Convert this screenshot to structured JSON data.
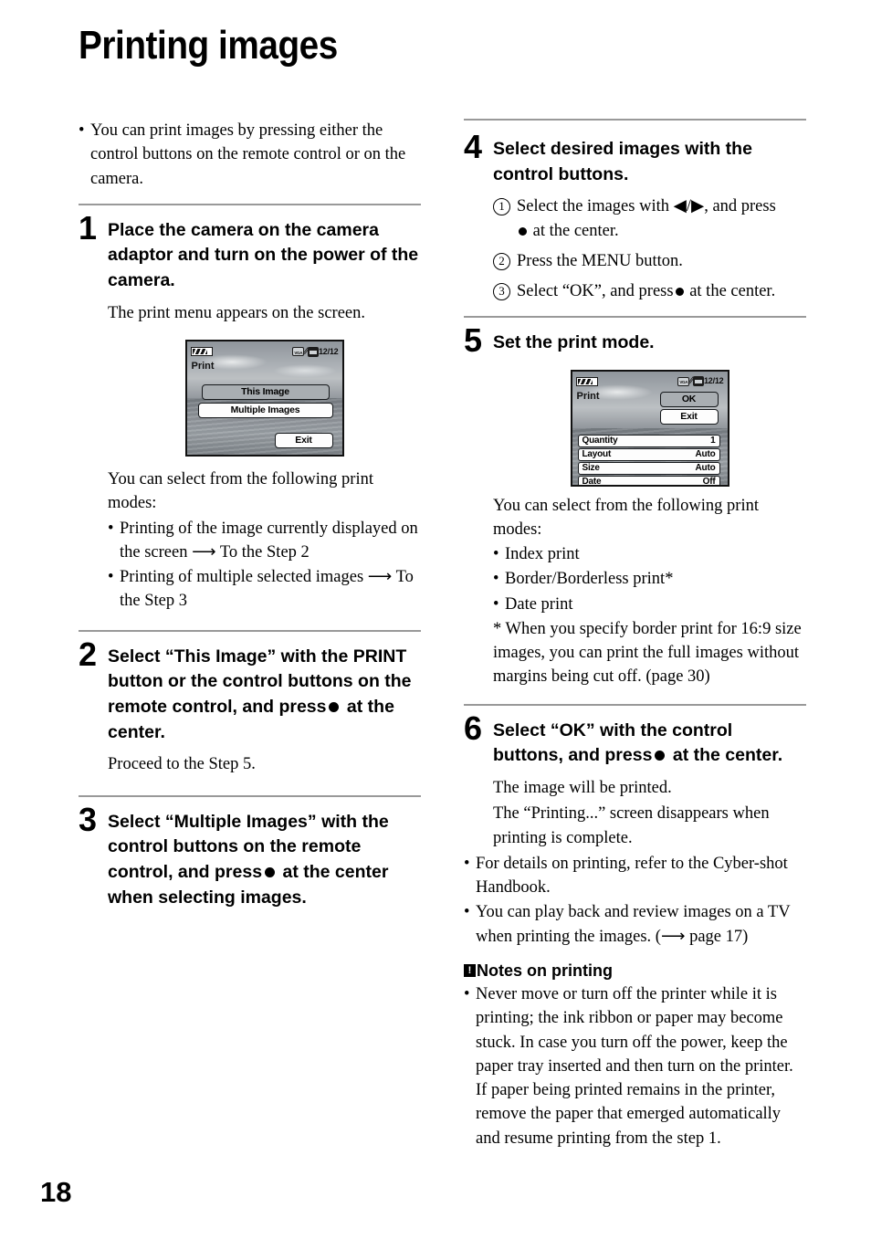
{
  "document": {
    "title": "Printing images",
    "page_number": "18"
  },
  "intro": {
    "bullet_mark": "•",
    "text": "You can print images by pressing either the control buttons on the remote control or on the camera."
  },
  "steps": {
    "step1": {
      "number": "1",
      "title": "Place the camera on the camera adaptor and turn on the power of the camera.",
      "body": "The print menu appears on the screen.",
      "caption_intro": "You can select from the following print modes:",
      "modes": [
        "Printing of the image currently displayed on the screen ⟶ To the Step 2",
        "Printing of multiple selected images ⟶ To the Step 3"
      ]
    },
    "step2": {
      "number": "2",
      "title_a": "Select “This Image” with the PRINT button or the control buttons on the remote control, and press",
      "title_b": "at the center.",
      "body": "Proceed to the Step 5."
    },
    "step3": {
      "number": "3",
      "title_a": "Select “Multiple Images” with the control buttons on the remote control, and press",
      "title_b": "at the center when selecting images."
    },
    "step4": {
      "number": "4",
      "title": "Select desired images with the control buttons.",
      "items": [
        {
          "marker": "1",
          "text_a": "Select the images with ◀/▶, and press",
          "text_b": "at the center."
        },
        {
          "marker": "2",
          "text_a": "Press the MENU button.",
          "text_b": ""
        },
        {
          "marker": "3",
          "text_a": "Select “OK”, and press",
          "text_b": "at the center."
        }
      ]
    },
    "step5": {
      "number": "5",
      "title": "Set the print mode.",
      "caption_intro": "You can select from the following print modes:",
      "modes": [
        "Index print",
        "Border/Borderless print*",
        "Date print"
      ],
      "footnote": "* When you specify border print for 16:9 size images, you can print the full images without margins being cut off. (page 30)"
    },
    "step6": {
      "number": "6",
      "title_a": "Select “OK” with the control buttons, and press",
      "title_b": "at the center.",
      "body_1": "The image will be printed.",
      "body_2": "The “Printing...” screen disappears when printing is complete.",
      "bullets": [
        "For details on printing, refer to the Cyber-shot Handbook.",
        "You can play back and review images on a TV when printing the images. (⟶ page 17)"
      ]
    }
  },
  "notes": {
    "badge": "!",
    "heading": "Notes on printing",
    "items": [
      "Never move or turn off the printer while it is printing; the ink ribbon or paper may become stuck. In case you turn off the power, keep the paper tray inserted and then turn on the printer. If paper being printed remains in the printer, remove the paper that emerged automatically and resume printing from the step 1."
    ]
  },
  "lcd_screen_1": {
    "status_count": "12/12",
    "mode_label": "Print",
    "buttons": [
      {
        "label": "This Image",
        "state": "selected"
      },
      {
        "label": "Multiple Images",
        "state": "normal"
      },
      {
        "label": "Exit",
        "state": "normal"
      }
    ],
    "icons": [
      "battery-icon",
      "vga-icon",
      "zigzag-icon",
      "memory-card-icon"
    ]
  },
  "lcd_screen_2": {
    "status_count": "12/12",
    "mode_label": "Print",
    "buttons": [
      {
        "label": "OK",
        "state": "selected"
      },
      {
        "label": "Exit",
        "state": "normal"
      }
    ],
    "settings": [
      {
        "label": "Quantity",
        "value": "1"
      },
      {
        "label": "Layout",
        "value": "Auto"
      },
      {
        "label": "Size",
        "value": "Auto"
      },
      {
        "label": "Date",
        "value": "Off"
      }
    ],
    "icons": [
      "battery-icon",
      "vga-icon",
      "zigzag-icon",
      "memory-card-icon"
    ]
  },
  "colors": {
    "rule": "#999999",
    "text": "#000000",
    "lcd_background": "#8d9399",
    "lcd_button_selected": "#a9aeb2",
    "lcd_button_normal": "#fdfdfd"
  }
}
